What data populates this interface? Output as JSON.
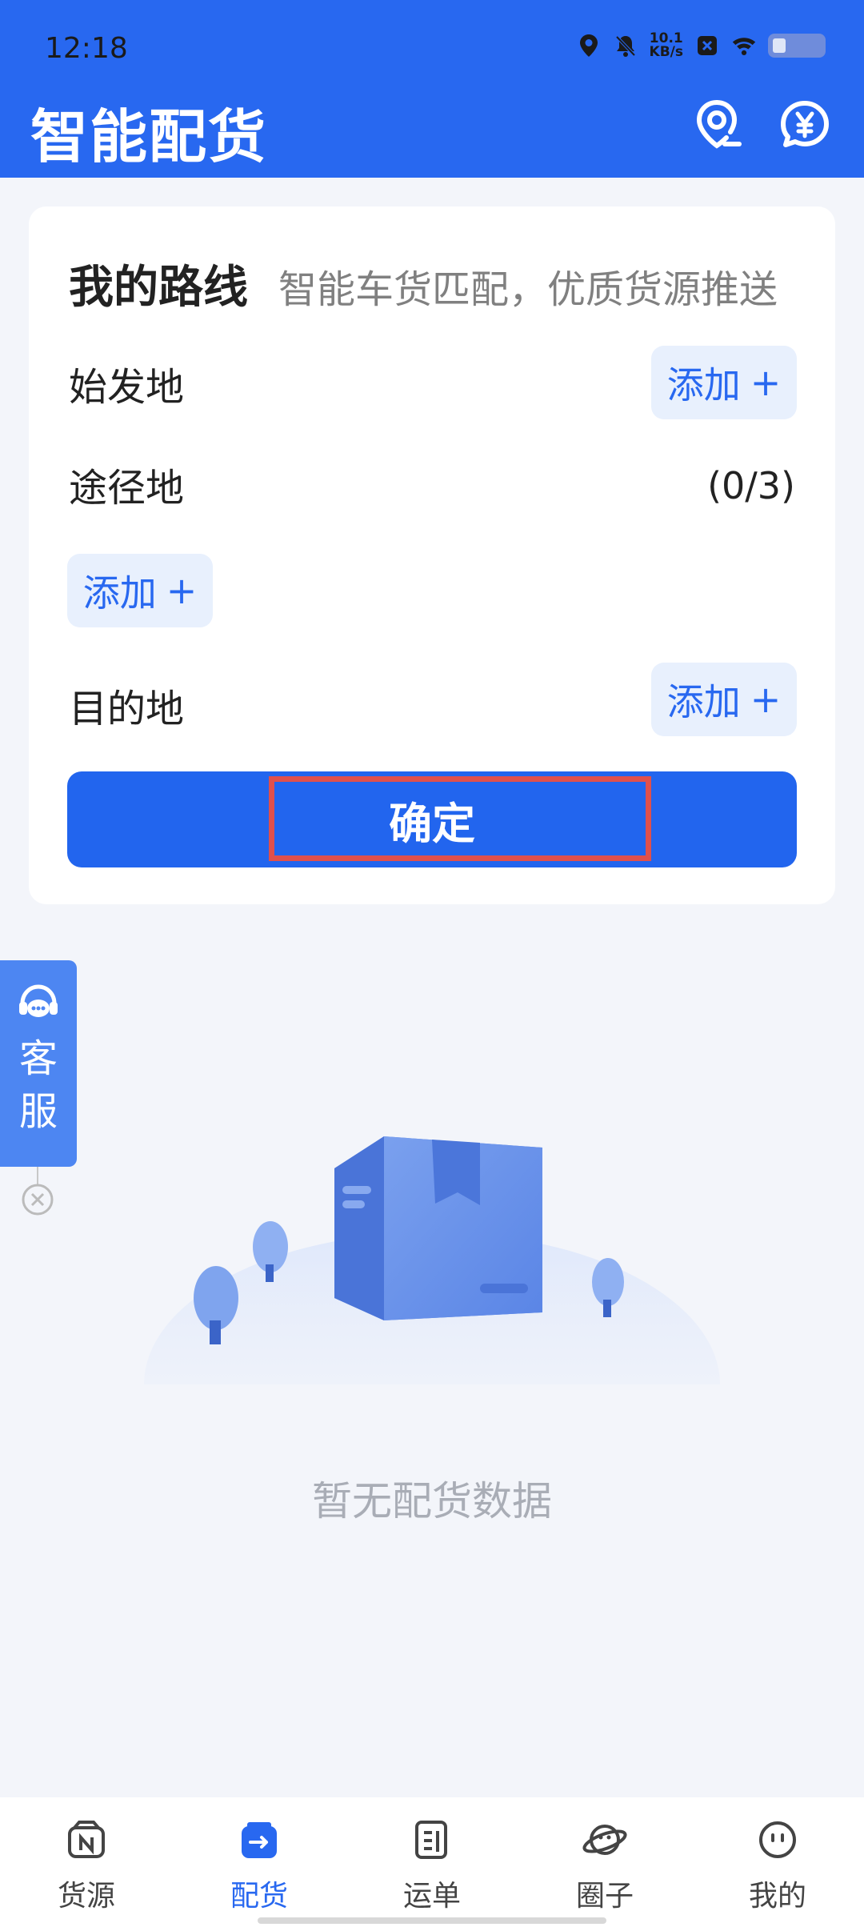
{
  "status_bar": {
    "time": "12:18",
    "net_speed_value": "10.1",
    "net_speed_unit": "KB/s"
  },
  "header": {
    "title": "智能配货",
    "icons": [
      "location-pin-icon",
      "yuan-chat-icon"
    ]
  },
  "route_card": {
    "title": "我的路线",
    "subtitle": "智能车货匹配，优质货源推送",
    "origin_label": "始发地",
    "via_label": "途径地",
    "via_count": "(0/3)",
    "destination_label": "目的地",
    "add_label": "添加",
    "add_symbol": "+",
    "confirm_label": "确定"
  },
  "customer_service": {
    "line1": "客",
    "line2": "服"
  },
  "empty_state": {
    "message": "暂无配货数据"
  },
  "bottom_nav": {
    "items": [
      {
        "label": "货源",
        "icon": "cargo-source-icon",
        "active": false
      },
      {
        "label": "配货",
        "icon": "dispatch-icon",
        "active": true
      },
      {
        "label": "运单",
        "icon": "waybill-icon",
        "active": false
      },
      {
        "label": "圈子",
        "icon": "planet-icon",
        "active": false
      },
      {
        "label": "我的",
        "icon": "profile-face-icon",
        "active": false
      }
    ]
  },
  "colors": {
    "primary": "#2868f0",
    "background": "#f3f5fa",
    "highlight_border": "#e0504c"
  }
}
